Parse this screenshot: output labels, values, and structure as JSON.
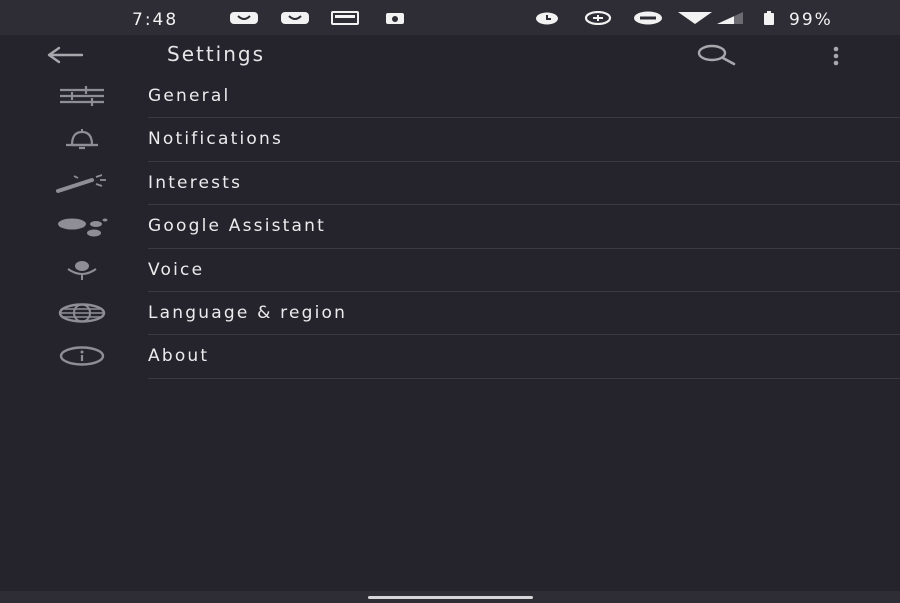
{
  "status_bar": {
    "time": "7:48",
    "battery": "99%",
    "left_icons": [
      "bird-notification-icon",
      "bird-notification-icon",
      "card-notification-icon",
      "android-notification-icon"
    ],
    "right_icons": [
      "alarm-icon",
      "data-saver-icon",
      "do-not-disturb-icon",
      "wifi-icon",
      "cell-signal-icon",
      "battery-icon"
    ]
  },
  "app_bar": {
    "title": "Settings",
    "icons": [
      "back-arrow-icon",
      "search-icon",
      "more-vert-icon"
    ]
  },
  "settings": [
    {
      "label": "General",
      "icon": "sliders-icon"
    },
    {
      "label": "Notifications",
      "icon": "bell-icon"
    },
    {
      "label": "Interests",
      "icon": "magic-wand-icon"
    },
    {
      "label": "Google Assistant",
      "icon": "assistant-icon"
    },
    {
      "label": "Voice",
      "icon": "mic-icon"
    },
    {
      "label": "Language & region",
      "icon": "globe-icon"
    },
    {
      "label": "About",
      "icon": "info-icon"
    }
  ],
  "colors": {
    "background": "#25242c",
    "status_bar": "#2e2d35",
    "icon": "#8f8e96",
    "text": "#ececee",
    "divider": "#3b3a42"
  }
}
